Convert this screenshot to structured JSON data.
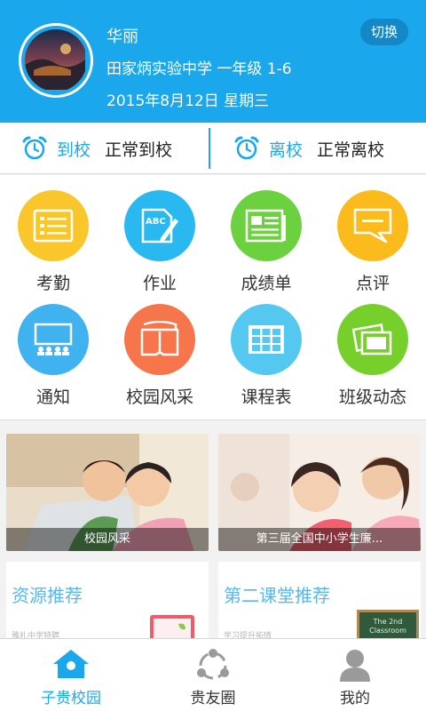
{
  "header": {
    "name": "华丽",
    "class_info": "田家炳实验中学 一年级 1-6",
    "date": "2015年8月12日 星期三",
    "switch_label": "切换"
  },
  "attendance": {
    "arrive_label": "到校",
    "arrive_status": "正常到校",
    "leave_label": "离校",
    "leave_status": "正常离校"
  },
  "grid": [
    {
      "label": "考勤",
      "color": "#f9c62c",
      "icon": "attendance-list-icon"
    },
    {
      "label": "作业",
      "color": "#29b9f0",
      "icon": "homework-abc-icon"
    },
    {
      "label": "成绩单",
      "color": "#6bd13f",
      "icon": "report-card-icon"
    },
    {
      "label": "点评",
      "color": "#fbbb1c",
      "icon": "comment-bubble-icon"
    },
    {
      "label": "通知",
      "color": "#3fb2ef",
      "icon": "notice-screen-icon"
    },
    {
      "label": "校园风采",
      "color": "#f6754a",
      "icon": "campus-book-icon"
    },
    {
      "label": "课程表",
      "color": "#55c8f1",
      "icon": "schedule-table-icon"
    },
    {
      "label": "班级动态",
      "color": "#76cf2a",
      "icon": "class-photos-icon"
    }
  ],
  "banners": {
    "left_caption": "校园风采",
    "right_caption": "第三届全国中小学生廉..."
  },
  "recommend": {
    "left_title": "资源推荐",
    "left_sub": "雅礼中学特聘",
    "right_title": "第二课堂推荐",
    "right_sub": "学习提升拓情",
    "board_text_1": "The 2nd",
    "board_text_2": "Classroom"
  },
  "nav": {
    "home": "子贵校园",
    "circle": "贵友圈",
    "mine": "我的",
    "active_color": "#1aa7ec",
    "inactive_color": "#333333"
  }
}
